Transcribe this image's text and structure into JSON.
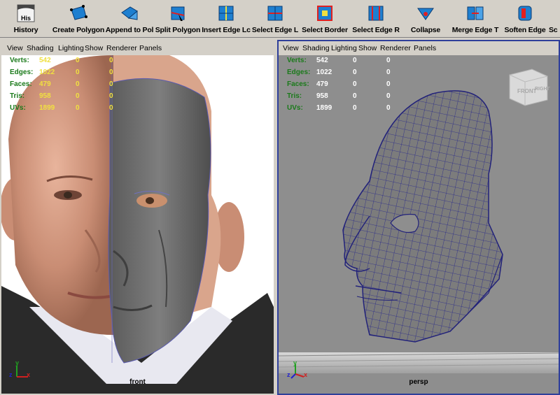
{
  "toolbar": {
    "items": [
      {
        "label": "History",
        "icon": "history-icon",
        "badge": "His"
      },
      {
        "label": "Create Polygon",
        "icon": "create-polygon-icon"
      },
      {
        "label": "Append to Pol",
        "icon": "append-polygon-icon"
      },
      {
        "label": "Split Polygon",
        "icon": "split-polygon-icon"
      },
      {
        "label": "Insert Edge Lc",
        "icon": "insert-edge-loop-icon"
      },
      {
        "label": "Select Edge L",
        "icon": "select-edge-loop-icon"
      },
      {
        "label": "Select Border",
        "icon": "select-border-icon"
      },
      {
        "label": "Select Edge R",
        "icon": "select-edge-ring-icon"
      },
      {
        "label": "Collapse",
        "icon": "collapse-icon"
      },
      {
        "label": "Merge Edge T",
        "icon": "merge-edge-icon"
      },
      {
        "label": "Soften Edge",
        "icon": "soften-edge-icon"
      },
      {
        "label": "Sc",
        "icon": "sculpt-icon"
      }
    ]
  },
  "viewport_menu": [
    "View",
    "Shading",
    "Lighting",
    "Show",
    "Renderer",
    "Panels"
  ],
  "hud": [
    {
      "key": "Verts:",
      "v1": "542",
      "v2": "0",
      "v3": "0"
    },
    {
      "key": "Edges:",
      "v1": "1022",
      "v2": "0",
      "v3": "0"
    },
    {
      "key": "Faces:",
      "v1": "479",
      "v2": "0",
      "v3": "0"
    },
    {
      "key": "Tris:",
      "v1": "958",
      "v2": "0",
      "v3": "0"
    },
    {
      "key": "UVs:",
      "v1": "1899",
      "v2": "0",
      "v3": "0"
    }
  ],
  "left_viewport": {
    "camera": "front",
    "axis_y": "y",
    "axis_z": "z",
    "axis_x": "x"
  },
  "right_viewport": {
    "camera": "persp",
    "axis_y": "y",
    "axis_z": "z",
    "axis_x": "x",
    "view_cube_front": "FRONT",
    "view_cube_right": "RIGHT"
  },
  "colors": {
    "hud_key": "#1a7a1a",
    "hud_value_left": "#f0e040",
    "hud_value_right": "#ffffff",
    "active_border": "#2f3f9a",
    "wire": "#2a2a90",
    "mesh": "#7a7a7a"
  }
}
